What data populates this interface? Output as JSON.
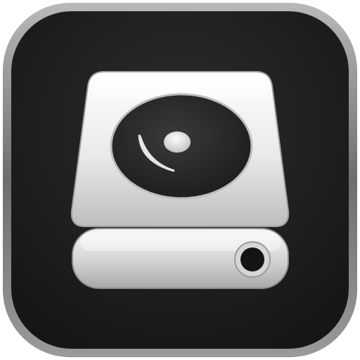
{
  "icon": {
    "name": "external-drive-icon",
    "colors": {
      "tile_dark": "#1f1f1f",
      "tile_border": "#8a8a8a",
      "drive_light": "#f4f4f4",
      "drive_shadow": "#9a9a9a",
      "platter_dark": "#262626",
      "led_dark": "#141414"
    }
  }
}
